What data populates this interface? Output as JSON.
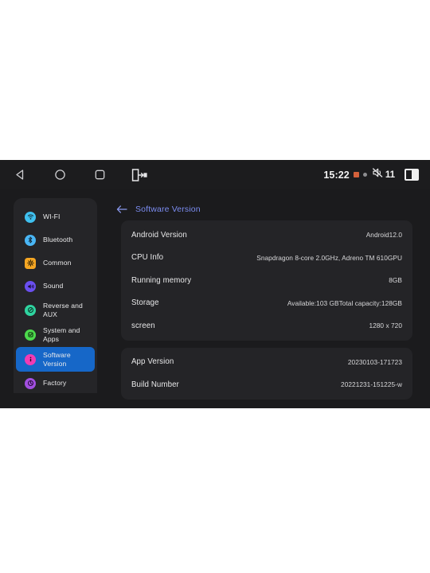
{
  "status_bar": {
    "nav": [
      {
        "name": "back-nav-icon",
        "label": "Back"
      },
      {
        "name": "home-nav-icon",
        "label": "Home"
      },
      {
        "name": "recents-nav-icon",
        "label": "Recents"
      },
      {
        "name": "exit-app-icon",
        "label": "Exit"
      }
    ],
    "clock": "15:22",
    "indicator_square_color": "#d4613b",
    "indicator_dot_color": "#8d8d90",
    "volume_muted_icon": "speaker-mute-icon",
    "volume_level": "11",
    "split_screen_icon": "split-screen-icon"
  },
  "sidebar": {
    "items": [
      {
        "label": "WI-FI",
        "icon": "wifi-icon",
        "color": "#3fc0ef",
        "shape": "circle",
        "selected": false
      },
      {
        "label": "Bluetooth",
        "icon": "bluetooth-icon",
        "color": "#49b6f5",
        "shape": "circle",
        "selected": false
      },
      {
        "label": "Common",
        "icon": "gear-icon",
        "color": "#f5a623",
        "shape": "square",
        "selected": false
      },
      {
        "label": "Sound",
        "icon": "speaker-icon",
        "color": "#6a4ff0",
        "shape": "circle",
        "selected": false
      },
      {
        "label": "Reverse and AUX",
        "icon": "reverse-camera-icon",
        "color": "#2fd4a0",
        "shape": "circle",
        "selected": false
      },
      {
        "label": "System and Apps",
        "icon": "apps-icon",
        "color": "#4cd94c",
        "shape": "circle",
        "selected": false
      },
      {
        "label": "Software Version",
        "icon": "info-icon",
        "color": "#f03bb4",
        "shape": "circle",
        "selected": true
      },
      {
        "label": "Factory",
        "icon": "factory-icon",
        "color": "#a24fe0",
        "shape": "circle",
        "selected": false
      }
    ],
    "selected_bg": "#1667c8"
  },
  "content": {
    "back_icon": "back-arrow-icon",
    "title": "Software Version",
    "title_color": "#7b8cf0",
    "cards": [
      {
        "rows": [
          {
            "label": "Android Version",
            "value": "Android12.0"
          },
          {
            "label": "CPU Info",
            "value": "Snapdragon 8-core 2.0GHz, Adreno TM 610GPU"
          },
          {
            "label": "Running memory",
            "value": "8GB"
          },
          {
            "label": "Storage",
            "value": "Available:103 GBTotal capacity:128GB"
          },
          {
            "label": "screen",
            "value": "1280 x 720"
          }
        ]
      },
      {
        "rows": [
          {
            "label": "App Version",
            "value": "20230103-171723"
          },
          {
            "label": "Build Number",
            "value": "20221231-151225-w"
          }
        ]
      }
    ]
  }
}
